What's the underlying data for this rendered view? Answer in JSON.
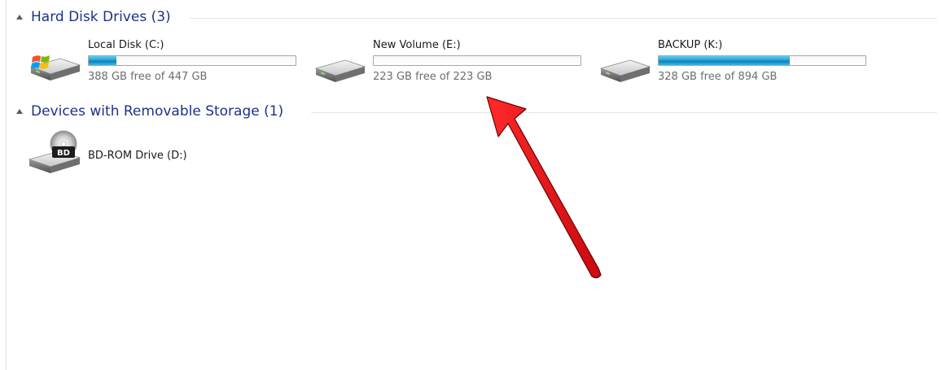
{
  "groups": [
    {
      "title": "Hard Disk Drives (3)",
      "drives": [
        {
          "name": "Local Disk (C:)",
          "free_text": "388 GB free of 447 GB",
          "used_fraction": 0.132,
          "icon": "windows-drive-icon"
        },
        {
          "name": "New Volume (E:)",
          "free_text": "223 GB free of 223 GB",
          "used_fraction": 0.0,
          "icon": "hard-drive-icon"
        },
        {
          "name": "BACKUP (K:)",
          "free_text": "328 GB free of 894 GB",
          "used_fraction": 0.633,
          "icon": "hard-drive-icon"
        }
      ]
    },
    {
      "title": "Devices with Removable Storage (1)",
      "devices": [
        {
          "name": "BD-ROM Drive (D:)",
          "icon": "bd-rom-drive-icon",
          "icon_label": "BD"
        }
      ]
    }
  ],
  "colors": {
    "header_text": "#1e3287",
    "bar_fill": "#26a0da",
    "annotation_arrow": "#e8141a"
  }
}
